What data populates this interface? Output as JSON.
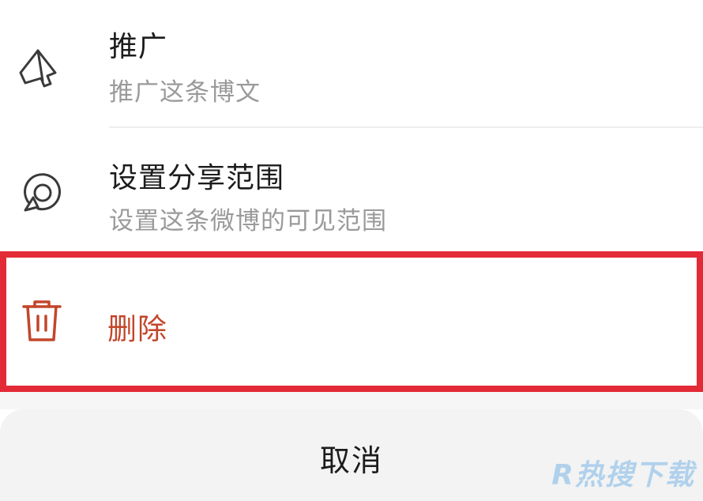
{
  "menu": {
    "items": [
      {
        "id": "promote",
        "icon": "megaphone-icon",
        "title": "推广",
        "subtitle": "推广这条博文"
      },
      {
        "id": "share-scope",
        "icon": "share-scope-icon",
        "title": "设置分享范围",
        "subtitle": "设置这条微博的可见范围"
      },
      {
        "id": "delete",
        "icon": "trash-icon",
        "title": "删除",
        "highlighted": true
      }
    ],
    "cancel_label": "取消"
  },
  "watermark": "R热搜下载",
  "colors": {
    "delete_text": "#c2462b",
    "highlight_border": "#e32a37",
    "title_text": "#1c1c1c",
    "subtitle_text": "#9a9a9a",
    "cancel_background": "#f3f3f3"
  }
}
